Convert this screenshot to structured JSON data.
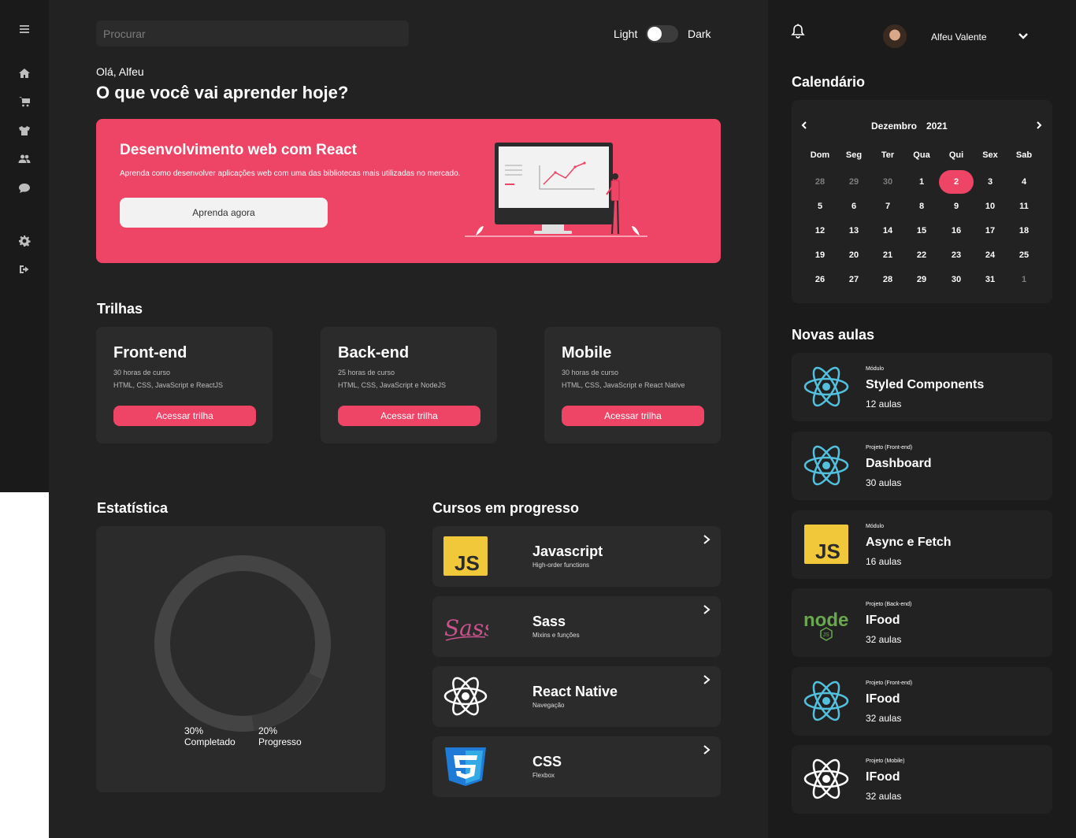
{
  "sidebar": {
    "icons": [
      "menu-icon",
      "home-icon",
      "cart-icon",
      "shirt-icon",
      "users-icon",
      "chat-icon",
      "gear-icon",
      "logout-icon"
    ]
  },
  "header": {
    "search_placeholder": "Procurar",
    "theme_light": "Light",
    "theme_dark": "Dark",
    "theme_toggle_state": "light"
  },
  "greeting": {
    "hello": "Olá, Alfeu",
    "headline": "O que você vai aprender hoje?"
  },
  "hero": {
    "title": "Desenvolvimento web com React",
    "description": "Aprenda como desenvolver aplicações web com uma das bibliotecas mais utilizadas no mercado.",
    "button": "Aprenda agora",
    "accent": "#ee4466"
  },
  "trails": {
    "title": "Trilhas",
    "items": [
      {
        "title": "Front-end",
        "hours": "30 horas de curso",
        "stack": "HTML, CSS, JavaScript e ReactJS",
        "button": "Acessar trilha"
      },
      {
        "title": "Back-end",
        "hours": "25 horas de curso",
        "stack": "HTML, CSS, JavaScript e NodeJS",
        "button": "Acessar trilha"
      },
      {
        "title": "Mobile",
        "hours": "30 horas de curso",
        "stack": "HTML, CSS, JavaScript e React Native",
        "button": "Acessar trilha"
      }
    ]
  },
  "stats": {
    "title": "Estatística",
    "completed_pct": "30%",
    "completed_label": "Completado",
    "progress_pct": "20%",
    "progress_label": "Progresso"
  },
  "courses": {
    "title": "Cursos em progresso",
    "items": [
      {
        "title": "Javascript",
        "subtitle": "High-order functions",
        "icon": "js-icon"
      },
      {
        "title": "Sass",
        "subtitle": "Mixins e funções",
        "icon": "sass-icon"
      },
      {
        "title": "React Native",
        "subtitle": "Navegação",
        "icon": "react-icon"
      },
      {
        "title": "CSS",
        "subtitle": "Flexbox",
        "icon": "css3-icon"
      }
    ]
  },
  "user": {
    "name": "Alfeu Valente"
  },
  "calendar": {
    "title": "Calendário",
    "month": "Dezembro",
    "year": "2021",
    "weekdays": [
      "Dom",
      "Seg",
      "Ter",
      "Qua",
      "Qui",
      "Sex",
      "Sab"
    ],
    "days": [
      "28",
      "29",
      "30",
      "1",
      "2",
      "3",
      "4",
      "5",
      "6",
      "7",
      "8",
      "9",
      "10",
      "11",
      "12",
      "13",
      "14",
      "15",
      "16",
      "17",
      "18",
      "19",
      "20",
      "21",
      "22",
      "23",
      "24",
      "25",
      "26",
      "27",
      "28",
      "29",
      "30",
      "31",
      "1"
    ],
    "selected": "2"
  },
  "new_lessons": {
    "title": "Novas aulas",
    "items": [
      {
        "category": "Módulo",
        "title": "Styled Components",
        "count": "12 aulas",
        "icon": "react-icon"
      },
      {
        "category": "Projeto (Front-end)",
        "title": "Dashboard",
        "count": "30 aulas",
        "icon": "react-icon"
      },
      {
        "category": "Módulo",
        "title": "Async e Fetch",
        "count": "16 aulas",
        "icon": "js-icon"
      },
      {
        "category": "Projeto (Back-end)",
        "title": "IFood",
        "count": "32 aulas",
        "icon": "nodejs-icon"
      },
      {
        "category": "Projeto (Front-end)",
        "title": "IFood",
        "count": "32 aulas",
        "icon": "react-icon"
      },
      {
        "category": "Projeto (Mobile)",
        "title": "IFood",
        "count": "32 aulas",
        "icon": "react-native-icon"
      }
    ]
  }
}
